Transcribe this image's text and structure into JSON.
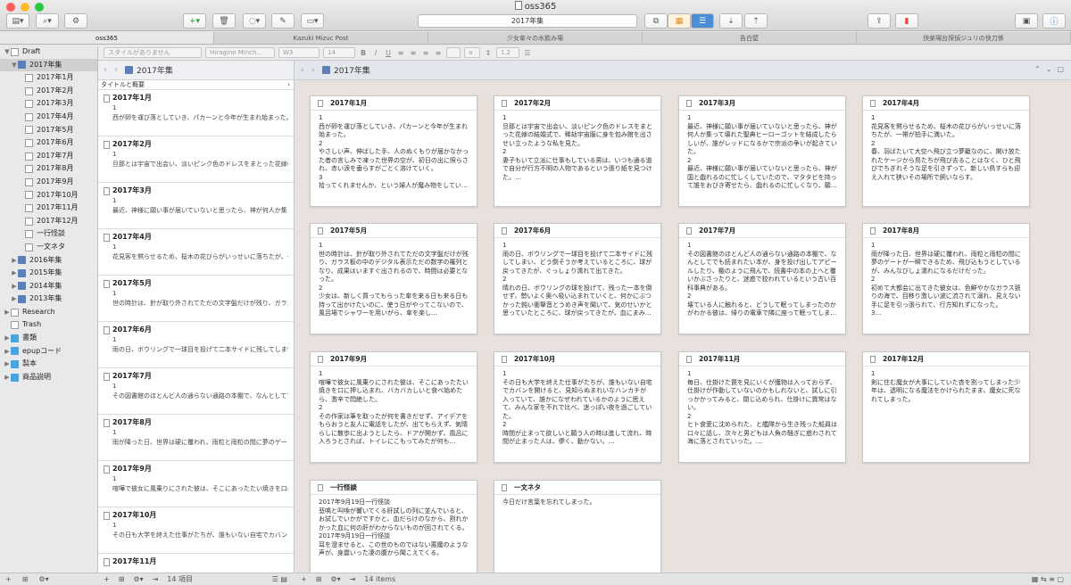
{
  "window": {
    "title": "oss365"
  },
  "toolbar": {
    "search_text": "2017年集"
  },
  "tabs": [
    "oss365",
    "Kazuki Mizuc Post",
    "少女傘々の水飲み場",
    "告白壁",
    "快楽場台探偵ジュリの快刀係"
  ],
  "format_bar": {
    "style": "スタイルがありません",
    "font": "Hiragino Minch...",
    "weight": "W3",
    "size": "14",
    "line_spacing": "1.2"
  },
  "binder": {
    "items": [
      {
        "label": "Draft",
        "level": 0,
        "icon": "draft-icon",
        "tri": "▼"
      },
      {
        "label": "2017年集",
        "level": 1,
        "icon": "book-icon",
        "tri": "▼",
        "selected": true
      },
      {
        "label": "2017年1月",
        "level": 2,
        "icon": "doc-icon"
      },
      {
        "label": "2017年2月",
        "level": 2,
        "icon": "doc-icon"
      },
      {
        "label": "2017年3月",
        "level": 2,
        "icon": "doc-icon"
      },
      {
        "label": "2017年4月",
        "level": 2,
        "icon": "doc-icon"
      },
      {
        "label": "2017年5月",
        "level": 2,
        "icon": "doc-icon"
      },
      {
        "label": "2017年6月",
        "level": 2,
        "icon": "doc-icon"
      },
      {
        "label": "2017年7月",
        "level": 2,
        "icon": "doc-icon"
      },
      {
        "label": "2017年8月",
        "level": 2,
        "icon": "doc-icon"
      },
      {
        "label": "2017年9月",
        "level": 2,
        "icon": "doc-icon"
      },
      {
        "label": "2017年10月",
        "level": 2,
        "icon": "doc-icon"
      },
      {
        "label": "2017年11月",
        "level": 2,
        "icon": "doc-icon"
      },
      {
        "label": "2017年12月",
        "level": 2,
        "icon": "doc-icon"
      },
      {
        "label": "一行怪談",
        "level": 2,
        "icon": "doc-icon"
      },
      {
        "label": "一文ネタ",
        "level": 2,
        "icon": "doc-icon"
      },
      {
        "label": "2016年集",
        "level": 1,
        "icon": "book-icon",
        "tri": "▶"
      },
      {
        "label": "2015年集",
        "level": 1,
        "icon": "book-icon",
        "tri": "▶"
      },
      {
        "label": "2014年集",
        "level": 1,
        "icon": "book-icon",
        "tri": "▶"
      },
      {
        "label": "2013年集",
        "level": 1,
        "icon": "book-icon",
        "tri": "▶"
      },
      {
        "label": "Research",
        "level": 0,
        "icon": "research-icon",
        "tri": "▶"
      },
      {
        "label": "Trash",
        "level": 0,
        "icon": "trash-icon"
      },
      {
        "label": "書類",
        "level": 0,
        "icon": "folder-icon",
        "tri": "▶"
      },
      {
        "label": "epupコード",
        "level": 0,
        "icon": "folder-icon",
        "tri": "▶"
      },
      {
        "label": "製本",
        "level": 0,
        "icon": "folder-icon",
        "tri": "▶"
      },
      {
        "label": "商品説明",
        "level": 0,
        "icon": "folder-icon",
        "tri": "▶"
      }
    ]
  },
  "list": {
    "header": "2017年集",
    "subheader": "タイトルと概要",
    "items": [
      {
        "title": "2017年1月",
        "line1": "1",
        "line2": "西が卵を運び落としていき、パカーンと今年が生まれ始まった。"
      },
      {
        "title": "2017年2月",
        "line1": "1",
        "line2": "旦那とは宇宙で出会い、淡いピンク色のドレスをまとった花嫁の結婚式で"
      },
      {
        "title": "2017年3月",
        "line1": "1",
        "line2": "最近、神様に願い事が届いていないと思ったら、神が何人か集って"
      },
      {
        "title": "2017年4月",
        "line1": "1",
        "line2": "花見客を黙らせるため、桜木の花びらがいっせいに落ちたが、一帯が拍手に満いた。"
      },
      {
        "title": "2017年5月",
        "line1": "1",
        "line2": "世の時計は、針が取り外されてただの文字盤だけが残り、ガラス板の中のデジタル表示"
      },
      {
        "title": "2017年6月",
        "line1": "1",
        "line2": "雨の日、ボウリングで一球目を投げて二本サイドに残してしまい、どう倒そうか考えている"
      },
      {
        "title": "2017年7月",
        "line1": "1",
        "line2": "その図書館のほとんど人の通らない通路の本棚で、なんとしてでも読まれたい本が、身を投げ出してアピール"
      },
      {
        "title": "2017年8月",
        "line1": "1",
        "line2": "雨が降った日、世界は硬に覆われ、雨粒と雨粒の間に夢のゲートが一瞬できるため、飛び込もうとしているが"
      },
      {
        "title": "2017年9月",
        "line1": "1",
        "line2": "喧嘩で彼女に風乗りにされた彼は、そこにあったたい焼きを口に押し込まれ、バカバカしいと食べ始めたら"
      },
      {
        "title": "2017年10月",
        "line1": "1",
        "line2": "その日も大学を終えた仕事がたちが、誰もいない自宅でカバンを開けると、見知らぬまれいなハンカチが"
      },
      {
        "title": "2017年11月",
        "line1": "",
        "line2": ""
      }
    ]
  },
  "cork": {
    "header": "2017年集",
    "cards": [
      {
        "title": "2017年1月",
        "body": "1\n西が卵を運び落としていき、パカーンと今年が生まれ始まった。\n2\nやさしい声、伸ばした手、人のぬくもりが届かなかった者の言しみで凍った世界の空が、初日の出に照らされ、赤い涙を垂らすがごとく溶けていく。\n3\n拾ってくれませんか、という婦人が魔み物をしてい…"
      },
      {
        "title": "2017年2月",
        "body": "1\n旦那とは宇宙で出会い、淡いピンク色のドレスをまとった花嫁の結婚式で、稀劫宇宙服に身を包み館を出させい立ったような私を見た。\n2\n妻子もいて立派に仕事もしている男は、いつも通る道で自分が行方不明の人物であるという張り紙を見つけた。…"
      },
      {
        "title": "2017年3月",
        "body": "1\n最近、神様に願い事が届いていないと思ったら、神が何人か集って壊れた聖典ヒーローゴットを結成したらしいが、誰がレッドになるかで宗派の争いが起きていた。\n2\n最近、神様に願い事が届いていないと思ったら、神が国と戯れるのに忙しくしていたので、マタタビを持って誰をおびき寄せたら、戯れるのに忙しくなり、願…"
      },
      {
        "title": "2017年4月",
        "body": "1\n花見客を黙らせるため、桜木の花びらがいっせいに落ちたが、一帯が拍手に満いた。\n2\n春、羽ばたいて大空へ飛び立つ夢籠なのに、開け放たれたケージから鳥たちが飛び去ることはなく、ひと飛びでちぎれそうな足を引きずって、新しい鳥すらも迎え入れて狭いその場所で飼いならす。"
      },
      {
        "title": "2017年5月",
        "body": "1\n世の時計は、針が取り外されてただの文字盤だけが残り、ガラス板の中のデジタル表示ただの数字の羅列となり、成果はいますぐ出されるので、時間は必要となった。\n2\n少女は、新しく買ってもらった傘を来る日も来る日も持って出かけたいのに、使う日がやってこないので、風呂場でシャワーを用いがら、傘を楽し…"
      },
      {
        "title": "2017年6月",
        "body": "1\n雨の日、ボウリングで一球目を投げて二本サイドに残してしまい、どう倒そうか考えているところに、球が戻ってきたが、ぐっしょり濡れて出てきた。\n2\n晴れの日、ボウリングの球を投げて、残った一本を倒せず、勢いよく奥へ吸い込まれていくと、何かにぶつかった鈍い衝撃音とうめき声を聞いて、気のせいかと思っていたところに、球が戻ってきたが、血にまみ…"
      },
      {
        "title": "2017年7月",
        "body": "1\nその図書館のほとんど人の通らない通路の本棚で、なんとしてでも読まれたい本が、身を投げ出してアピールしたり、棚のように飛んで、読書中の本の上へと覆いかぶさったりと、迷惑で狡われているという古い百科事典がある。\n2\n壊ている人に触れると、どうして眠ってしまったのかがわかる彼は、帰りの電車で隣に座って眠ってしま…"
      },
      {
        "title": "2017年8月",
        "body": "1\n雨が降った日、世界は硬に覆われ、雨粒と雨粒の間に夢のゲートが一瞬できるため、飛び込もうとしているが、みんなびしょ濡れになるだけだった。\n2\n初めて大都会に出てきた彼女は、色鮮やかなガラス張りの海で、目移り激しい波に流されて溺れ、見えない手に足を引っ張られて、行方知れずになった。\n3…"
      },
      {
        "title": "2017年9月",
        "body": "1\n喧嘩で彼女に風乗りにされた彼は、そこにあったたい焼きを口に押し込まれ、バカバカしいと食べ始めたら、激辛で悶絶した。\n2\nその作家は筆を取ったが何を書きだせず、アイデアをもらおうと友人に電話をしたが、出てもらえず、気晴らしに散歩に出ようとしたら、ドアが開かず、風呂に入ろうとされば、トイレにこもってみたが何も…"
      },
      {
        "title": "2017年10月",
        "body": "1\nその日も大学を終えた仕事がたちが、誰もいない自宅でカバンを開けると、見知らぬまれいなハンカチが入っていて、誰かになぜわれているかのように思えて、みんな家を不れで比べ、迷っぽい夜を過ごしていた。\n2\n時間が止まって欲しいと願う人の時は進して流れ、時間が止まった人は、儚く、動かない。…"
      },
      {
        "title": "2017年11月",
        "body": "1\n毎日、仕掛けた罠を見にいくが獲物は入っておらず、仕掛けが作動していないのかもしれないと、試しに引っかかってみると、閉じ込められ、仕掛けに異常はない。\n2\nヒト食愛に沈められた、と艦隊から生き残った船員は口々に話し、次々と男どもは人魚の騒ぎに惑わされて海に落とされていった。…"
      },
      {
        "title": "2017年12月",
        "body": "1\n剣に住む魔女が大事にしていた杏を割ってしまった少年は、透明になる魔法をかけられたまま、魔女に死なれてしまった。"
      },
      {
        "title": "一行怪談",
        "body": "2017年9月19日一行怪談\n悲鳴と叫喚が響いてくる肝試しの列に並んでいると、お試しでいかがですかと、血だらけのなから、割れかかった血に何の肝がわからないものが回されてくる。\n2017年9月19日一行怪談\n耳を澄ませると、この世のものではない悪魔のような声が、身震いった凄の腹から聞こえてくる。"
      },
      {
        "title": "一文ネタ",
        "body": "今日だけ言葉を忘れてしまった。"
      }
    ]
  },
  "status": {
    "list_count": "14 項目",
    "cork_count": "14 items"
  }
}
